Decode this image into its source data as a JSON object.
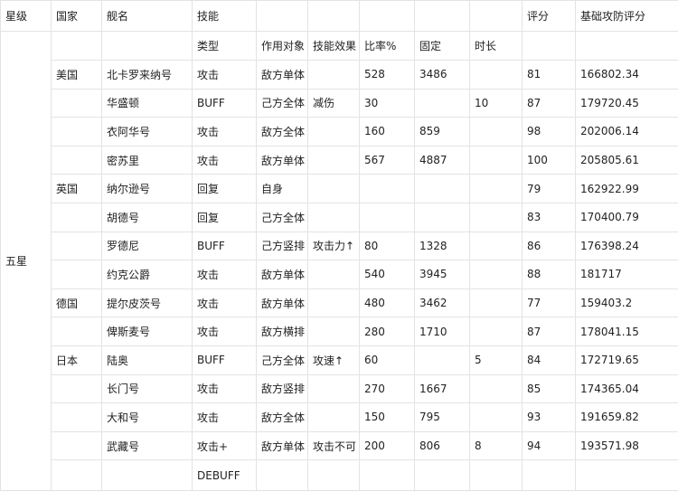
{
  "headers": {
    "star": "星级",
    "country": "国家",
    "ship": "舰名",
    "skill": "技能",
    "score": "评分",
    "base_score": "基础攻防评分"
  },
  "subheaders": {
    "type": "类型",
    "target": "作用对象",
    "effect": "技能效果",
    "ratio": "比率%",
    "fixed": "固定",
    "duration": "时长"
  },
  "star_label": "五星",
  "rows": [
    {
      "country": "美国",
      "ship": "北卡罗来纳号",
      "type": "攻击",
      "target": "敌方单体",
      "effect": "",
      "ratio": "528",
      "fixed": "3486",
      "duration": "",
      "score": "81",
      "base": "166802.34"
    },
    {
      "country": "",
      "ship": "华盛顿",
      "type": "BUFF",
      "target": "己方全体",
      "effect": "减伤",
      "ratio": "30",
      "fixed": "",
      "duration": "10",
      "score": "87",
      "base": "179720.45"
    },
    {
      "country": "",
      "ship": "衣阿华号",
      "type": "攻击",
      "target": "敌方全体",
      "effect": "",
      "ratio": "160",
      "fixed": "859",
      "duration": "",
      "score": "98",
      "base": "202006.14"
    },
    {
      "country": "",
      "ship": "密苏里",
      "type": "攻击",
      "target": "敌方单体",
      "effect": "",
      "ratio": "567",
      "fixed": "4887",
      "duration": "",
      "score": "100",
      "base": "205805.61"
    },
    {
      "country": "英国",
      "ship": "纳尔逊号",
      "type": "回复",
      "target": "自身",
      "effect": "",
      "ratio": "",
      "fixed": "",
      "duration": "",
      "score": "79",
      "base": "162922.99"
    },
    {
      "country": "",
      "ship": "胡德号",
      "type": "回复",
      "target": "己方全体",
      "effect": "",
      "ratio": "",
      "fixed": "",
      "duration": "",
      "score": "83",
      "base": "170400.79"
    },
    {
      "country": "",
      "ship": "罗德尼",
      "type": "BUFF",
      "target": "己方竖排",
      "effect": "攻击力↑",
      "ratio": "80",
      "fixed": "1328",
      "duration": "",
      "score": "86",
      "base": "176398.24"
    },
    {
      "country": "",
      "ship": "约克公爵",
      "type": "攻击",
      "target": "敌方单体",
      "effect": "",
      "ratio": "540",
      "fixed": "3945",
      "duration": "",
      "score": "88",
      "base": "181717"
    },
    {
      "country": "德国",
      "ship": "提尔皮茨号",
      "type": "攻击",
      "target": "敌方单体",
      "effect": "",
      "ratio": "480",
      "fixed": "3462",
      "duration": "",
      "score": "77",
      "base": "159403.2"
    },
    {
      "country": "",
      "ship": "俾斯麦号",
      "type": "攻击",
      "target": "敌方横排",
      "effect": "",
      "ratio": "280",
      "fixed": "1710",
      "duration": "",
      "score": "87",
      "base": "178041.15"
    },
    {
      "country": "日本",
      "ship": "陆奥",
      "type": "BUFF",
      "target": "己方全体",
      "effect": "攻速↑",
      "ratio": "60",
      "fixed": "",
      "duration": "5",
      "score": "84",
      "base": "172719.65"
    },
    {
      "country": "",
      "ship": "长门号",
      "type": "攻击",
      "target": "敌方竖排",
      "effect": "",
      "ratio": "270",
      "fixed": "1667",
      "duration": "",
      "score": "85",
      "base": "174365.04"
    },
    {
      "country": "",
      "ship": "大和号",
      "type": "攻击",
      "target": "敌方全体",
      "effect": "",
      "ratio": "150",
      "fixed": "795",
      "duration": "",
      "score": "93",
      "base": "191659.82"
    },
    {
      "country": "",
      "ship": "武藏号",
      "type": "攻击+",
      "target": "敌方单体",
      "effect": "攻击不可",
      "ratio": "200",
      "fixed": "806",
      "duration": "8",
      "score": "94",
      "base": "193571.98"
    },
    {
      "country": "",
      "ship": "",
      "type": "DEBUFF",
      "target": "",
      "effect": "",
      "ratio": "",
      "fixed": "",
      "duration": "",
      "score": "",
      "base": ""
    }
  ]
}
